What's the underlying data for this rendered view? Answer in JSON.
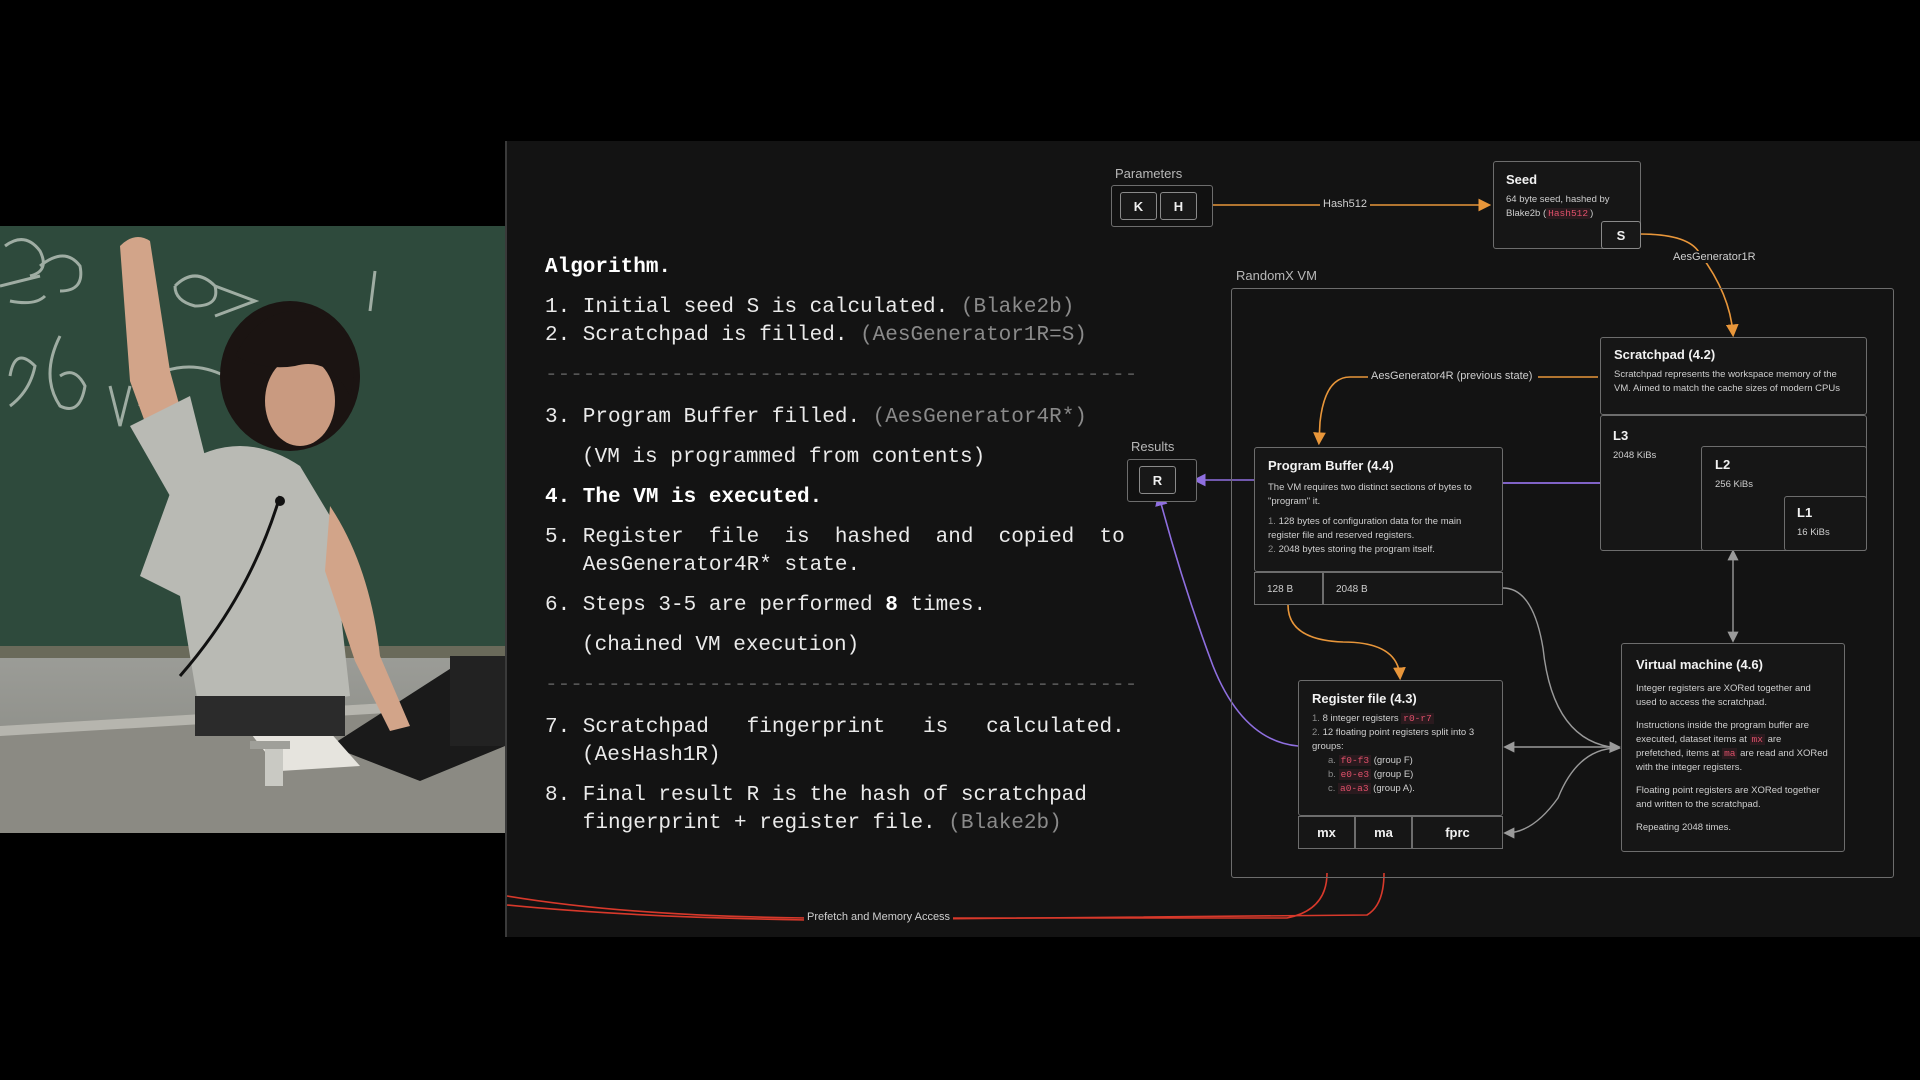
{
  "algorithm": {
    "heading": "Algorithm.",
    "step1": "1. Initial seed S is calculated.",
    "step1_note": "(Blake2b)",
    "step2": "2. Scratchpad is filled.",
    "step2_note": "(AesGenerator1R=S)",
    "separator": "-----------------------------------------------",
    "step3": "3. Program Buffer filled.",
    "step3_note": "(AesGenerator4R*)",
    "step3_sub": "(VM is programmed from contents)",
    "step4": "4. The VM is executed.",
    "step5_line1": "5. Register  file  is  hashed  and  copied  to",
    "step5_line2": "   AesGenerator4R* state.",
    "step6_pre": "6. Steps 3-5 are performed ",
    "step6_bold": "8",
    "step6_post": " times.",
    "step6_sub": "(chained VM execution)",
    "step7_line1": "7. Scratchpad   fingerprint   is   calculated.",
    "step7_note": "(AesHash1R)",
    "step8_line1": "8. Final result R is the hash of scratchpad",
    "step8_line2": "   fingerprint + register file.",
    "step8_note": "(Blake2b)"
  },
  "diagram": {
    "parameters_label": "Parameters",
    "key_k": "K",
    "key_h": "H",
    "hash512_label": "Hash512",
    "seed": {
      "title": "Seed",
      "desc_pre": "64 byte seed, hashed by Blake2b (",
      "desc_code": "Hash512",
      "desc_post": ")",
      "port": "S"
    },
    "aesgen1r_label": "AesGenerator1R",
    "vm_label": "RandomX VM",
    "aesgen4r_label": "AesGenerator4R (previous state)",
    "scratchpad": {
      "title": "Scratchpad (4.2)",
      "desc": "Scratchpad represents the workspace memory of the VM. Aimed to match the cache sizes of modern CPUs"
    },
    "cache": {
      "l3": "L3",
      "l3_size": "2048 KiBs",
      "l2": "L2",
      "l2_size": "256 KiBs",
      "l1": "L1",
      "l1_size": "16 KiBs"
    },
    "results_label": "Results",
    "result_r": "R",
    "program_buffer": {
      "title": "Program Buffer (4.4)",
      "desc": "The VM requires two distinct sections of bytes to \"program\" it.",
      "item1": "128 bytes of configuration data for the main register file and reserved registers.",
      "item2": "2048 bytes storing the program itself.",
      "cell1": "128 B",
      "cell2": "2048 B"
    },
    "register_file": {
      "title": "Register file (4.3)",
      "item1_pre": "8 integer registers ",
      "item1_code": "r0-r7",
      "item2": "12 floating point registers split into 3 groups:",
      "sub_a_code": "f0-f3",
      "sub_a_post": " (group F)",
      "sub_b_code": "e0-e3",
      "sub_b_post": " (group E)",
      "sub_c_code": "a0-a3",
      "sub_c_post": " (group A).",
      "cell_mx": "mx",
      "cell_ma": "ma",
      "cell_fprc": "fprc"
    },
    "virtual_machine": {
      "title": "Virtual machine (4.6)",
      "p1": "Integer registers are XORed together and used to access the scratchpad.",
      "p2_pre": "Instructions inside the program buffer are executed, dataset items at ",
      "p2_code1": "mx",
      "p2_mid": " are prefetched, items at ",
      "p2_code2": "ma",
      "p2_post": " are read and XORed with the integer registers.",
      "p3": "Floating point registers are XORed together and written to the scratchpad.",
      "p4": "Repeating 2048 times."
    },
    "prefetch_label": "Prefetch and Memory Access"
  },
  "colors": {
    "orange": "#e8963a",
    "purple": "#8f6fe0",
    "red": "#d8392b",
    "grey": "#9a9a9a"
  }
}
